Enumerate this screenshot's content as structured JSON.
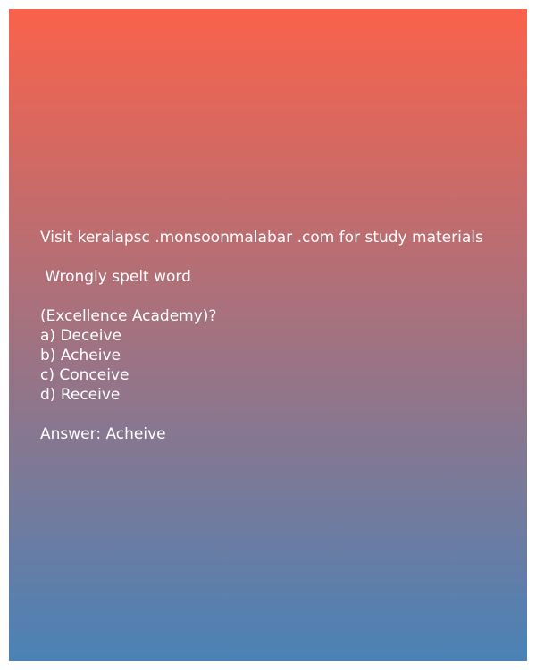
{
  "source_note": "Visit keralapsc .monsoonmalabar .com for study materials",
  "question": {
    "line1": " Wrongly spelt word",
    "line2": "(Excellence Academy)?"
  },
  "options": [
    "a) Deceive",
    "b) Acheive",
    "c) Conceive",
    "d) Receive"
  ],
  "answer": "Answer: Acheive",
  "colors": {
    "gradient_top": "#fa624b",
    "gradient_bottom": "#4a82b6",
    "text": "#ffffff"
  }
}
